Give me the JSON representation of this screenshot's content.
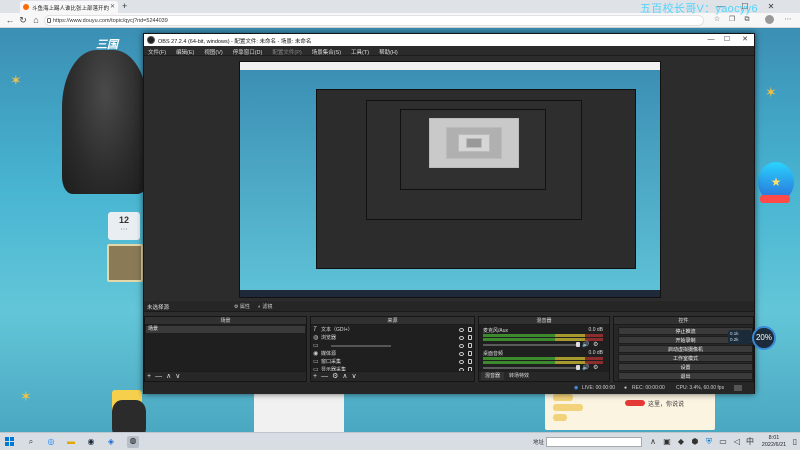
{
  "browser": {
    "tab_title": "斗鱼海上踢人谁比张上部落开的",
    "new_tab": "+",
    "url": "https://www.douyu.com/topic/qycj?rid=5244039",
    "window_min": "—",
    "window_max": "☐",
    "window_close": "✕"
  },
  "watermark": "五百校长哥V：yaocyy6",
  "page": {
    "logo": "三国",
    "card_number": "12",
    "chat_line": "这里，你说说"
  },
  "obs": {
    "title": "OBS 27.2.4 (64-bit, windows) - 配置文件: 未命名 - 场景: 未命名",
    "menu": [
      "文件(F)",
      "编辑(E)",
      "视图(V)",
      "停靠窗口(D)",
      "配置文件(P)",
      "场景集合(S)",
      "工具(T)",
      "帮助(H)"
    ],
    "no_source": "未选择源",
    "properties": "属性",
    "filters": "滤镜",
    "docks": {
      "scenes_title": "场景",
      "scene_item": "场景",
      "sources_title": "来源",
      "sources": [
        {
          "icon": "T",
          "label": "文本（GDI+）"
        },
        {
          "icon": "◍",
          "label": "浏览器"
        },
        {
          "icon": "▭",
          "label": ""
        },
        {
          "icon": "◉",
          "label": "媒体源"
        },
        {
          "icon": "▭",
          "label": "窗口采集"
        },
        {
          "icon": "▭",
          "label": "显示器采集"
        }
      ],
      "mixer_title": "混音器",
      "mixer": [
        {
          "label": "麦克风/Aux",
          "db": "0.0 dB"
        },
        {
          "label": "桌面音频",
          "db": "0.0 dB"
        }
      ],
      "mixer_tabs": [
        "混音器",
        "转场特效"
      ],
      "controls_title": "控件",
      "controls": [
        "停止推流",
        "开始录制",
        "启动虚拟摄像机",
        "工作室模式",
        "设置",
        "退出"
      ]
    },
    "footer_symbols": [
      "+",
      "—",
      "∧",
      "∨"
    ],
    "source_footer_symbols": [
      "+",
      "—",
      "⚙",
      "∧",
      "∨"
    ],
    "status": {
      "live": "LIVE: 00:00:00",
      "rec": "REC: 00:00:00",
      "cpu": "CPU: 3.4%, 60.00 fps"
    }
  },
  "overlay": {
    "percent": "20%",
    "net_up": "0.1k",
    "net_down": "0.2k"
  },
  "taskbar": {
    "search_label": "地址",
    "time": "8:01",
    "date": "2022/6/21"
  },
  "colors": {
    "obs_bg": "#2d2d2e",
    "meter_green": "#3c8a2d",
    "meter_yellow": "#a69a2e",
    "meter_red": "#8b2d2d",
    "watermark": "#3bd1ff",
    "win_accent": "#0078d4"
  }
}
